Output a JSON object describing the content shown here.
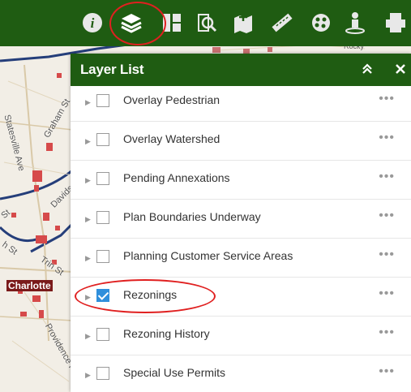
{
  "toolbar": {
    "tools": [
      {
        "icon": "info-icon"
      },
      {
        "icon": "layers-icon",
        "highlighted": true
      },
      {
        "icon": "basemap-gallery-icon"
      },
      {
        "icon": "zoom-search-icon"
      },
      {
        "icon": "map-add-icon"
      },
      {
        "icon": "measure-icon"
      },
      {
        "icon": "draw-icon"
      },
      {
        "icon": "directions-icon"
      },
      {
        "icon": "print-icon"
      }
    ],
    "background": "#1f5c12"
  },
  "map": {
    "labels": {
      "statesville": "Statesville Ave",
      "graham": "Graham St",
      "davidson": "Davidson",
      "trin": "Trin St",
      "st": "St",
      "h_st": "h St",
      "charlotte": "Charlotte",
      "providence": "Providence Rd",
      "top_road": "Rocky"
    }
  },
  "panel": {
    "title": "Layer List",
    "collapse_icon": "double-chevron-up-icon",
    "close_icon": "close-icon",
    "more_label": "•••",
    "layers": [
      {
        "label": "Overlay Pedestrian",
        "checked": false
      },
      {
        "label": "Overlay Watershed",
        "checked": false
      },
      {
        "label": "Pending Annexations",
        "checked": false
      },
      {
        "label": "Plan Boundaries Underway",
        "checked": false
      },
      {
        "label": "Planning Customer Service Areas",
        "checked": false
      },
      {
        "label": "Rezonings",
        "checked": true,
        "highlighted": true
      },
      {
        "label": "Rezoning History",
        "checked": false
      },
      {
        "label": "Special Use Permits",
        "checked": false
      }
    ]
  },
  "colors": {
    "header_green": "#1f5c12",
    "checkbox_blue": "#2f8fdc",
    "highlight_red": "#e02020"
  }
}
